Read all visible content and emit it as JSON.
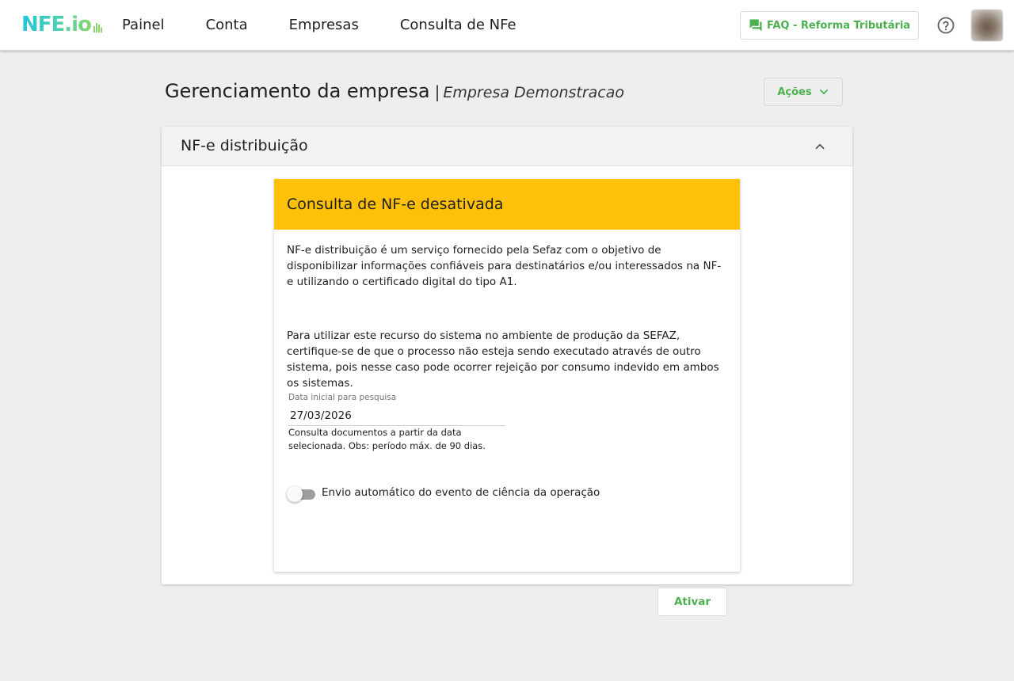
{
  "header": {
    "logo_text": "NFE.io",
    "nav": [
      "Painel",
      "Conta",
      "Empresas",
      "Consulta de NFe"
    ],
    "faq_label": "FAQ - Reforma Tributária",
    "accent_color": "#4caf50"
  },
  "page": {
    "title": "Gerenciamento da empresa",
    "separator": "|",
    "company": "Empresa Demonstracao",
    "actions_label": "Ações"
  },
  "panel": {
    "title": "NF-e distribuição"
  },
  "card": {
    "title": "Consulta de NF-e desativada",
    "header_color": "#ffc107",
    "paragraph1": "NF-e distribuição é um serviço fornecido pela Sefaz com o objetivo de disponibilizar informações confiáveis para destinatários e/ou interessados na NF-e utilizando o certificado digital do tipo A1.",
    "paragraph2": "Para utilizar este recurso do sistema no ambiente de produção da SEFAZ, certifique-se de que o processo não esteja sendo executado através de outro sistema, pois nesse caso pode ocorrer rejeição por consumo indevido em ambos os sistemas.",
    "date_field": {
      "label": "Data inicial para pesquisa",
      "value": "27/03/2026",
      "hint": "Consulta documentos a partir da data selecionada. Obs: período máx. de 90 dias."
    },
    "toggle": {
      "label": "Envio automático do evento de ciência da operação",
      "checked": false
    },
    "submit_label": "Ativar"
  }
}
